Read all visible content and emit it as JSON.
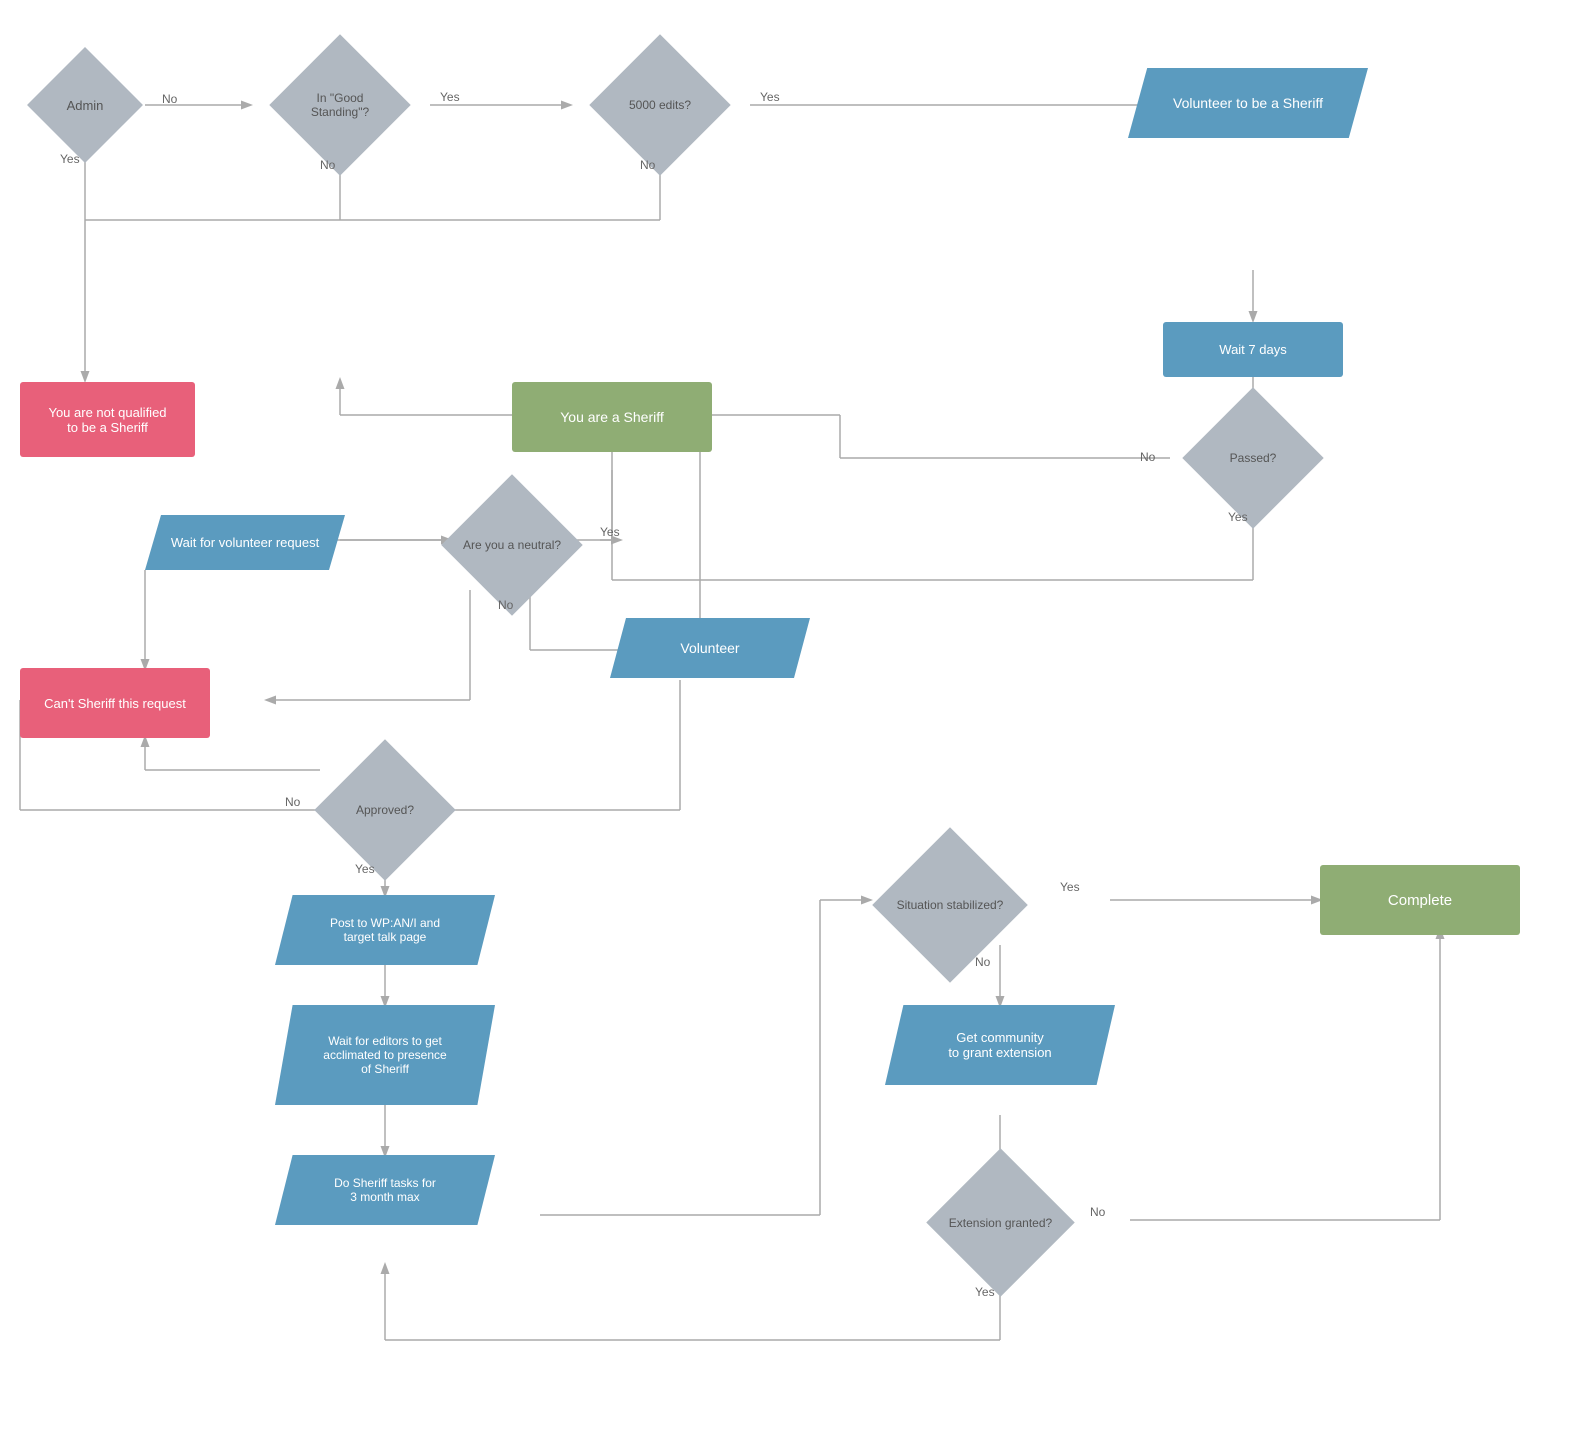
{
  "nodes": {
    "admin": "Admin",
    "good_standing": "In \"Good Standing\"?",
    "edits_5000": "5000 edits?",
    "volunteer": "Volunteer to be a Sheriff",
    "wait_7days": "Wait 7 days",
    "passed": "Passed?",
    "not_qualified": "You are not qualified\nto be a Sheriff",
    "you_are_sheriff": "You are a Sheriff",
    "wait_volunteer": "Wait for volunteer request",
    "are_you_neutral": "Are you\na neutral?",
    "volunteer_action": "Volunteer",
    "cant_sheriff": "Can't Sheriff this request",
    "approved": "Approved?",
    "post_wp": "Post to WP:AN/I and\ntarget talk page",
    "wait_editors": "Wait for editors to get\nacclimated to presence\nof Sheriff",
    "do_sheriff": "Do Sheriff tasks for\n3 month max",
    "situation_stabilized": "Situation stabilized?",
    "complete": "Complete",
    "get_community": "Get community\nto grant extension",
    "extension_granted": "Extension\ngranted?"
  },
  "labels": {
    "no": "No",
    "yes": "Yes"
  }
}
